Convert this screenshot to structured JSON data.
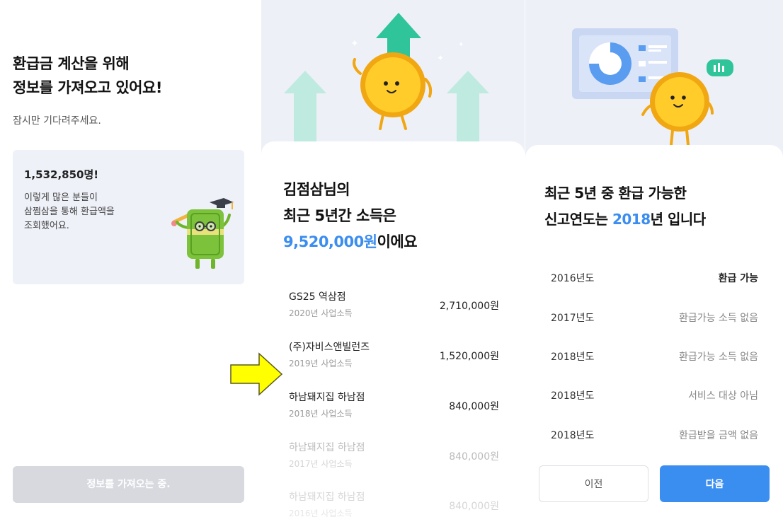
{
  "screen1": {
    "title_line1": "환급금 계산을 위해",
    "title_line2": "정보를 가져오고 있어요!",
    "subtitle": "잠시만 기다려주세요.",
    "card": {
      "count": "1,532,850명!",
      "desc_line1": "이렇게 많은 분들이",
      "desc_line2": "삼쩜삼을 통해 환급액을",
      "desc_line3": "조회했어요."
    },
    "button_label": "정보를 가져오는 중."
  },
  "screen2": {
    "title_line1": "김점삼님의",
    "title_line2": "최근 5년간 소득은",
    "amount_highlight": "9,520,000원",
    "amount_suffix": "이에요",
    "incomes": [
      {
        "name": "GS25 역삼점",
        "sub": "2020년 사업소득",
        "amount": "2,710,000원"
      },
      {
        "name": "(주)자비스앤빌런즈",
        "sub": "2019년 사업소득",
        "amount": "1,520,000원"
      },
      {
        "name": "하남돼지집 하남점",
        "sub": "2018년 사업소득",
        "amount": "840,000원"
      },
      {
        "name": "하남돼지집 하남점",
        "sub": "2017년 사업소득",
        "amount": "840,000원"
      },
      {
        "name": "하남돼지집 하남점",
        "sub": "2016년 사업소득",
        "amount": "840,000원"
      }
    ]
  },
  "screen3": {
    "title_line1": "최근 5년 중 환급 가능한",
    "title_prefix": "신고연도는 ",
    "title_year": "2018",
    "title_suffix": "년 입니다",
    "years": [
      {
        "year": "2016년도",
        "status": "환급 가능"
      },
      {
        "year": "2017년도",
        "status": "환급가능 소득 없음"
      },
      {
        "year": "2018년도",
        "status": "환급가능 소득 없음"
      },
      {
        "year": "2018년도",
        "status": "서비스 대상 아님"
      },
      {
        "year": "2018년도",
        "status": "환급받을 금액 없음"
      }
    ],
    "prev_label": "이전",
    "next_label": "다음"
  },
  "colors": {
    "accent": "#3b8df0",
    "panel_bg": "#eef0f7",
    "arrow_fill": "#ffff00",
    "teal": "#2fc49a"
  },
  "icons": {
    "mascot_money": "green-money-mascot",
    "mascot_coin": "gold-coin-mascot",
    "pointer": "yellow-right-arrow"
  }
}
